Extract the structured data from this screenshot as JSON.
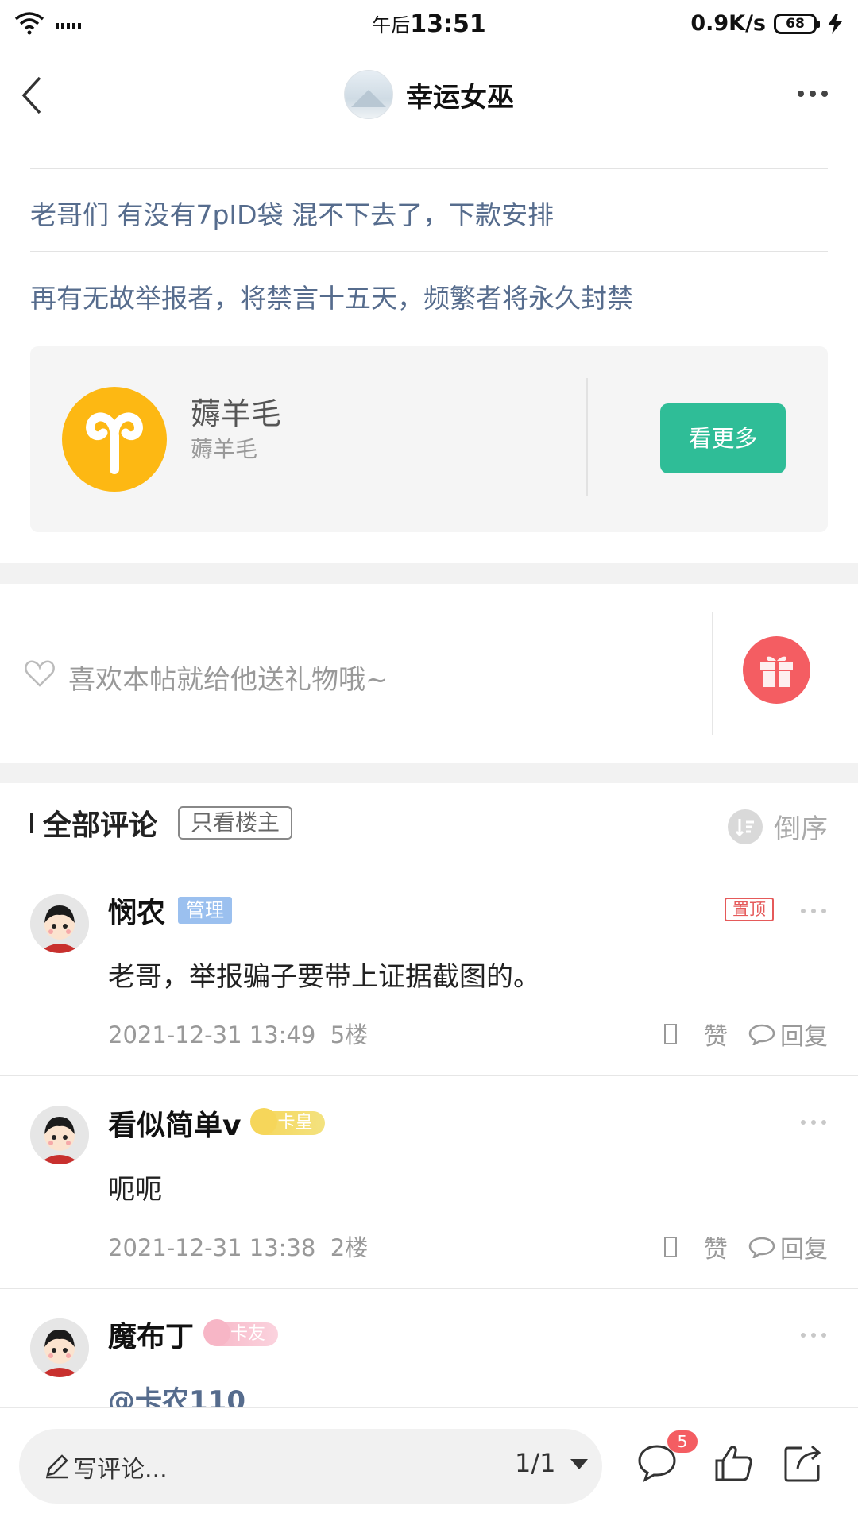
{
  "status_bar": {
    "time_prefix": "午后",
    "time": "13:51",
    "net_speed": "0.9K/s",
    "battery": "68"
  },
  "nav": {
    "title": "幸运女巫"
  },
  "notices": [
    "老哥们 有没有7pID袋 混不下去了，下款安排",
    "再有无故举报者，将禁言十五天，频繁者将永久封禁"
  ],
  "topic": {
    "name": "薅羊毛",
    "subtitle": "薅羊毛",
    "button_label": "看更多",
    "icon_color": "#fdb813",
    "button_color": "#2fbd97"
  },
  "gift": {
    "prompt": "喜欢本帖就给他送礼物哦~",
    "button_color": "#f45d62"
  },
  "comments_header": {
    "title": "全部评论",
    "only_op_label": "只看楼主",
    "sort_label": "倒序"
  },
  "comments": [
    {
      "name": "悯农",
      "badge": "管理",
      "pinned_label": "置顶",
      "text": "老哥，举报骗子要带上证据截图的。",
      "time": "2021-12-31 13:49",
      "floor": "5楼",
      "like_label": "赞",
      "reply_label": "回复"
    },
    {
      "name": "看似简单v",
      "badge": "卡皇",
      "text": "呃呃",
      "time": "2021-12-31 13:38",
      "floor": "2楼",
      "like_label": "赞",
      "reply_label": "回复"
    },
    {
      "name": "魔布丁",
      "badge": "卡友",
      "text": "@卡农110"
    }
  ],
  "bottom_bar": {
    "write_label": "写评论...",
    "page_indicator": "1/1",
    "comment_count": "5"
  },
  "icons": [
    "back-icon",
    "more-icon",
    "ram-icon",
    "heart-icon",
    "gift-icon",
    "sort-icon",
    "reply-icon",
    "pencil-icon",
    "comment-icon",
    "thumbs-up-icon",
    "share-icon",
    "wifi-icon",
    "signal-icon",
    "charging-icon",
    "crown-icon"
  ]
}
